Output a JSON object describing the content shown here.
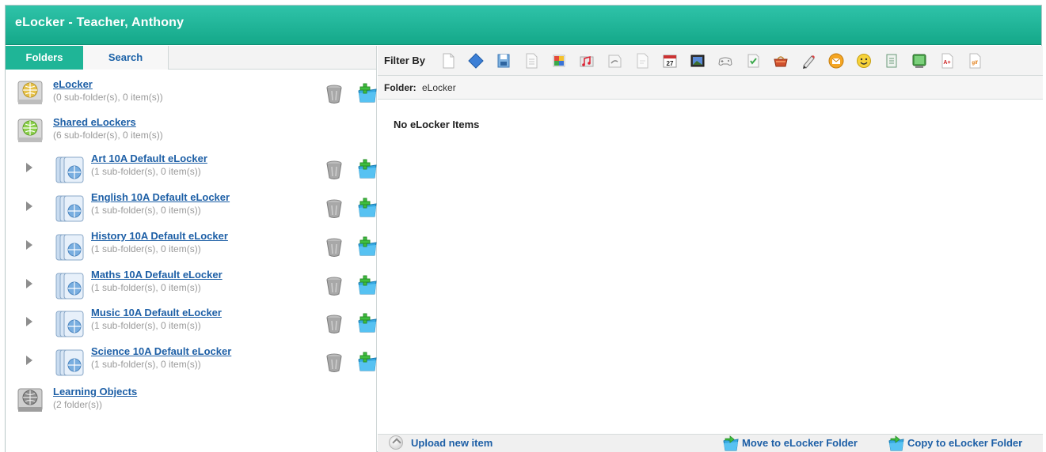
{
  "app": {
    "title": "eLocker - Teacher, Anthony"
  },
  "tabs": [
    {
      "label": "Folders",
      "active": true
    },
    {
      "label": "Search",
      "active": false
    }
  ],
  "tree": {
    "root": {
      "name": "eLocker",
      "sub": "(0 sub-folder(s), 0 item(s))",
      "icon": "globe-drive-icon"
    },
    "shared": {
      "name": "Shared eLockers",
      "sub": "(6 sub-folder(s), 0 item(s))",
      "icon": "globe-drive-icon"
    },
    "children": [
      {
        "name": "Art 10A Default eLocker",
        "sub": "(1 sub-folder(s), 0 item(s))"
      },
      {
        "name": "English 10A Default eLocker",
        "sub": "(1 sub-folder(s), 0 item(s))"
      },
      {
        "name": "History 10A Default eLocker",
        "sub": "(1 sub-folder(s), 0 item(s))"
      },
      {
        "name": "Maths 10A Default eLocker",
        "sub": "(1 sub-folder(s), 0 item(s))"
      },
      {
        "name": "Music 10A Default eLocker",
        "sub": "(1 sub-folder(s), 0 item(s))"
      },
      {
        "name": "Science 10A Default eLocker",
        "sub": "(1 sub-folder(s), 0 item(s))"
      }
    ],
    "learning": {
      "name": "Learning Objects",
      "sub": "(2 folder(s))",
      "icon": "gray-globe-drive-icon"
    }
  },
  "filter": {
    "label": "Filter By",
    "icons": [
      "document-icon",
      "diamond-icon",
      "save-disk-icon",
      "text-page-icon",
      "color-grid-icon",
      "music-icon",
      "link-page-icon",
      "blank-page-icon",
      "calendar-icon",
      "picture-icon",
      "gamepad-icon",
      "checklist-icon",
      "basket-icon",
      "pen-icon",
      "email-icon",
      "smiley-icon",
      "list-icon",
      "green-screen-icon",
      "pdf-icon",
      "gif-icon"
    ]
  },
  "folderbar": {
    "label": "Folder:",
    "value": "eLocker"
  },
  "content": {
    "empty_text": "No eLocker Items"
  },
  "footer": {
    "upload": "Upload new item",
    "move": "Move to eLocker Folder",
    "copy": "Copy to eLocker Folder"
  },
  "colors": {
    "header": "#1fb597",
    "link": "#1d5fa6",
    "muted": "#9a9a9a"
  }
}
